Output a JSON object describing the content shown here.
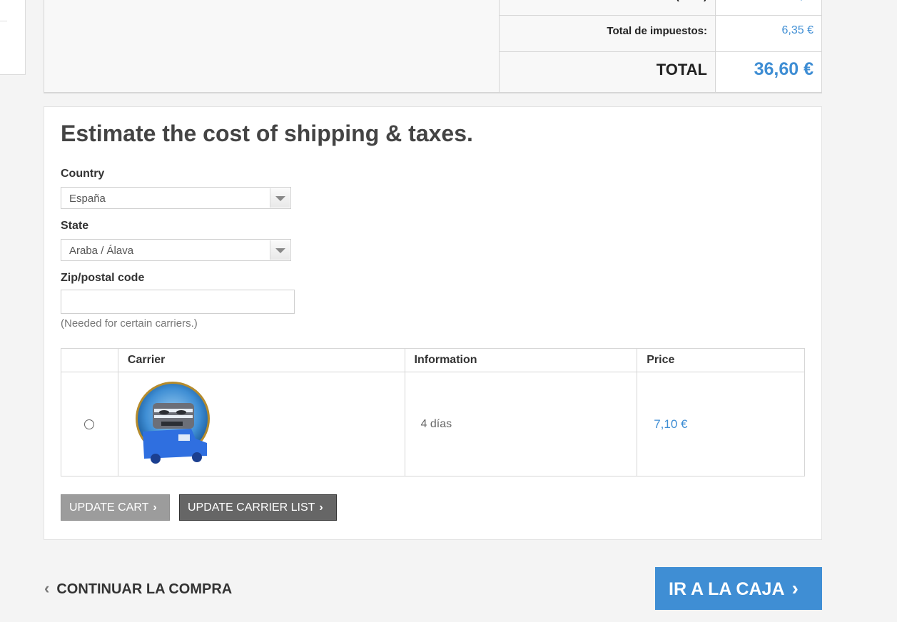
{
  "totals": {
    "cut_label": "(… …)",
    "cut_value": "…,…",
    "tax_label": "Total de impuestos:",
    "tax_value": "6,35 €",
    "total_label": "TOTAL",
    "total_value": "36,60 €"
  },
  "estimate": {
    "title": "Estimate the cost of shipping & taxes.",
    "country_label": "Country",
    "country_value": "España",
    "state_label": "State",
    "state_value": "Araba / Álava",
    "zip_label": "Zip/postal code",
    "zip_value": "",
    "zip_hint": "(Needed for certain carriers.)",
    "table": {
      "headers": [
        "",
        "Carrier",
        "Information",
        "Price"
      ],
      "rows": [
        {
          "carrier_logo": "delivery-van-logo",
          "information": "4 días",
          "price": "7,10 €"
        }
      ]
    },
    "update_cart_label": "UPDATE CART",
    "update_carrier_label": "UPDATE CARRIER LIST"
  },
  "footer": {
    "continue_label": "CONTINUAR LA COMPRA",
    "checkout_label": "IR A LA CAJA"
  },
  "colors": {
    "accent": "#3f8ed4",
    "update_cart_bg": "#9c9c9c",
    "update_carrier_bg": "#666666"
  }
}
